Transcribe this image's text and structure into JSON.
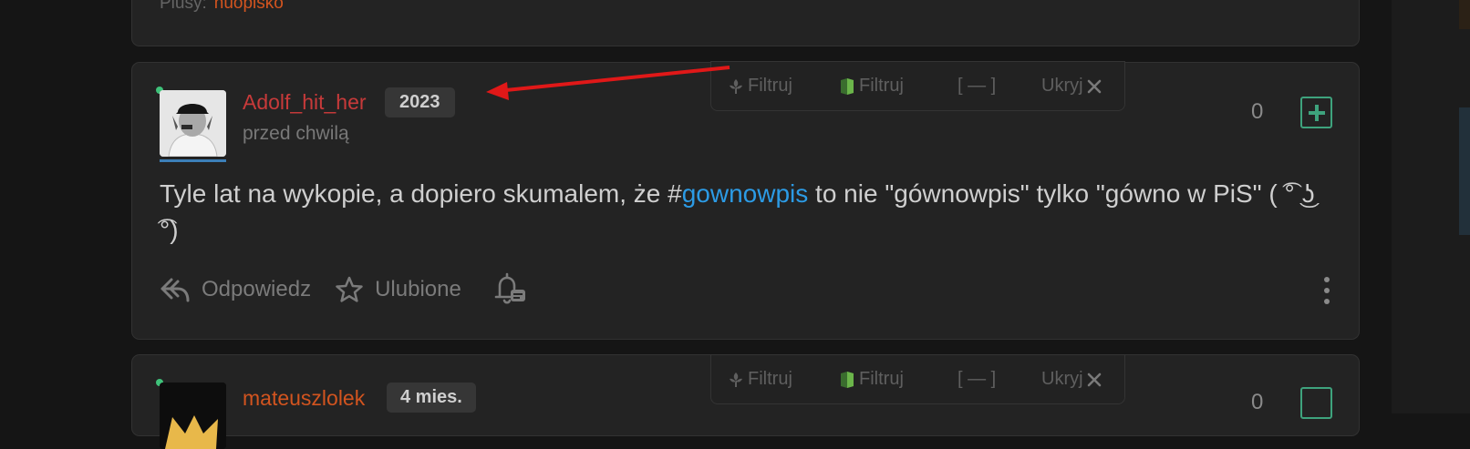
{
  "top_card": {
    "plusy_label": "Plusy:",
    "plusy_user": "huopisko"
  },
  "entry": {
    "author": "Adolf_hit_her",
    "account_age": "2023",
    "timestamp": "przed chwilą",
    "text_before_tag": "Tyle lat na wykopie, a dopiero skumalem, że #",
    "tag": "gownowpis",
    "text_after_tag": "  to nie \"gównowpis\" tylko \"gówno w PiS\" ( ͡° ͜ʖ ͡°)",
    "vote_count": "0",
    "actions": {
      "reply": "Odpowiedz",
      "favorite": "Ulubione"
    }
  },
  "filter_bar": {
    "filter_1": "Filtruj",
    "filter_2": "Filtruj",
    "collapse": "[ — ]",
    "hide": "Ukryj"
  },
  "next_entry": {
    "author": "mateuszlolek",
    "account_age": "4 mies.",
    "vote_count": "0"
  },
  "colors": {
    "background": "#151515",
    "card": "#232323",
    "author_red": "#c73a3a",
    "author_orange": "#d2541f",
    "tag_blue": "#2c9be5",
    "plus_green": "#3ea37d",
    "online_green": "#3fc27a",
    "arrow_red": "#e01818"
  }
}
